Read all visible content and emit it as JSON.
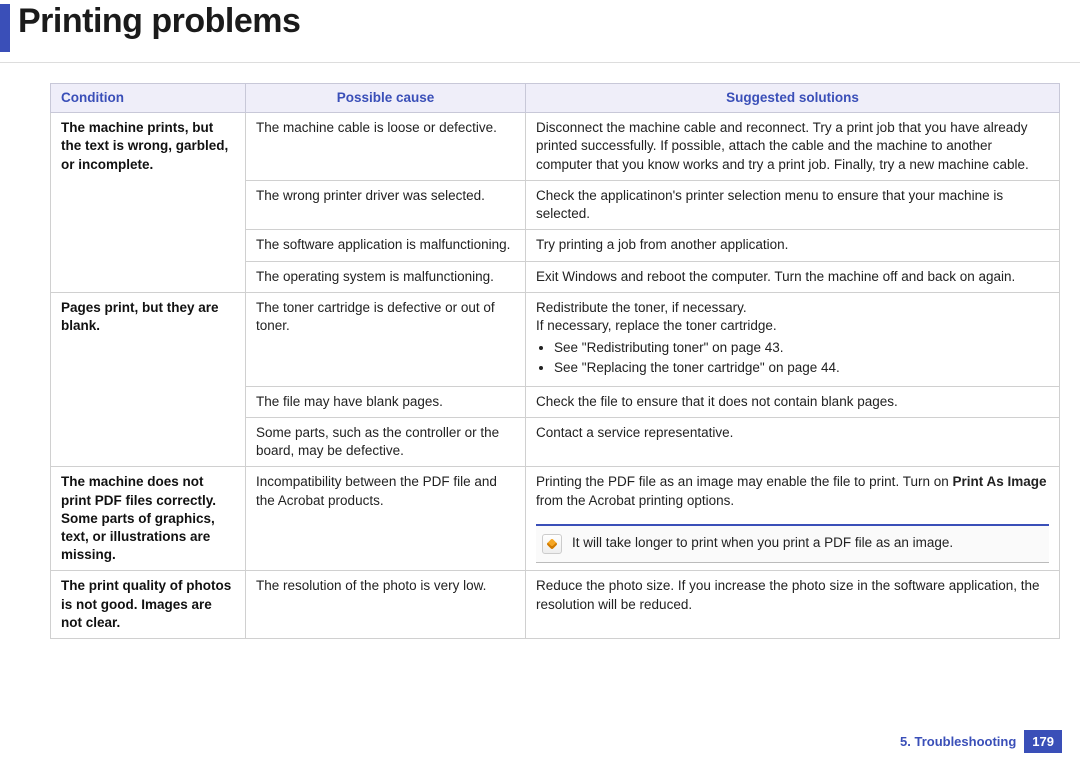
{
  "title": "Printing problems",
  "footer": {
    "chapter": "5.  Troubleshooting",
    "page_number": "179"
  },
  "table": {
    "headers": {
      "condition": "Condition",
      "cause": "Possible cause",
      "solution": "Suggested solutions"
    },
    "rows": {
      "r1": {
        "condition": "The machine prints, but the text is wrong, garbled, or incomplete.",
        "cause": "The machine cable is loose or defective.",
        "solution": "Disconnect the machine cable and reconnect. Try a print job that you have already printed successfully. If possible, attach the cable and the machine to another computer that you know works and try a print job. Finally, try a new machine cable."
      },
      "r2": {
        "cause": "The wrong printer driver was selected.",
        "solution": "Check the applicatinon's printer selection menu to ensure that your machine is selected."
      },
      "r3": {
        "cause": "The software application is malfunctioning.",
        "solution": "Try printing a job from another application."
      },
      "r4": {
        "cause": "The operating system is malfunctioning.",
        "solution": "Exit Windows and reboot the computer. Turn the machine off and back on again."
      },
      "r5": {
        "condition": "Pages print, but they are blank.",
        "cause": "The toner cartridge is defective or out of toner.",
        "solution_line1": "Redistribute the toner, if necessary.",
        "solution_line2": "If necessary, replace the toner cartridge.",
        "solution_lis": [
          "See \"Redistributing toner\" on page 43.",
          "See \"Replacing the toner cartridge\" on page 44."
        ]
      },
      "r6": {
        "cause": "The file may have blank pages.",
        "solution": "Check the file to ensure that it does not contain blank pages."
      },
      "r7": {
        "cause": "Some parts, such as the controller or the board, may be defective.",
        "solution": "Contact a service representative."
      },
      "r8": {
        "condition": "The machine does not print PDF files correctly. Some parts of graphics, text, or illustrations are missing.",
        "cause": "Incompatibility between the PDF file and the Acrobat products.",
        "solution_pre": "Printing the PDF file as an image may enable the file to print. Turn on ",
        "solution_bold": "Print As Image",
        "solution_post": " from the Acrobat printing options.",
        "note": "It will take longer to print when you print a PDF file as an image."
      },
      "r9": {
        "condition": "The print quality of photos is not good. Images are not clear.",
        "cause": "The resolution of the photo is very low.",
        "solution": "Reduce the photo size. If you increase the photo size in the software application, the resolution will be reduced."
      }
    }
  }
}
